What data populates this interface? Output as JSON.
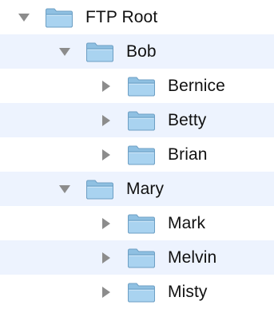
{
  "tree": {
    "colors": {
      "row_alt": "#edf3fe",
      "disclosure": "#8c8c8c",
      "folder_back": "#8fc0e2",
      "folder_front": "#a9d3f0",
      "folder_outline": "#6d9fc4",
      "text": "#111111"
    },
    "nodes": [
      {
        "label": "FTP Root",
        "state": "expanded",
        "icon": "folder-icon"
      },
      {
        "label": "Bob",
        "state": "expanded",
        "icon": "folder-icon"
      },
      {
        "label": "Bernice",
        "state": "collapsed",
        "icon": "folder-icon"
      },
      {
        "label": "Betty",
        "state": "collapsed",
        "icon": "folder-icon"
      },
      {
        "label": "Brian",
        "state": "collapsed",
        "icon": "folder-icon"
      },
      {
        "label": "Mary",
        "state": "expanded",
        "icon": "folder-icon"
      },
      {
        "label": "Mark",
        "state": "collapsed",
        "icon": "folder-icon"
      },
      {
        "label": "Melvin",
        "state": "collapsed",
        "icon": "folder-icon"
      },
      {
        "label": "Misty",
        "state": "collapsed",
        "icon": "folder-icon"
      }
    ]
  }
}
